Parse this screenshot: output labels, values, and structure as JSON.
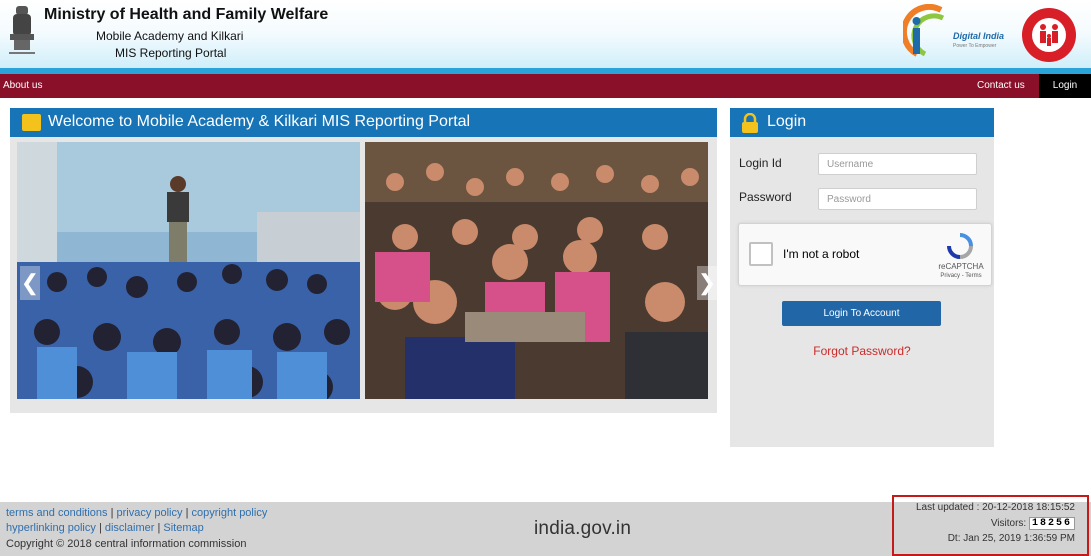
{
  "header": {
    "ministry": "Ministry of Health and Family Welfare",
    "portal_line1": "Mobile Academy and Kilkari",
    "portal_line2": "MIS Reporting Portal",
    "digital_india": "Digital India",
    "digital_india_tagline": "Power To Empower",
    "colors": {
      "nav": "#8a0f28",
      "accent": "#1674b7",
      "stripe": "#2aa3d9"
    }
  },
  "nav": {
    "about": "About us",
    "contact": "Contact us",
    "login": "Login"
  },
  "welcome": {
    "title": "Welcome to Mobile Academy & Kilkari MIS Reporting Portal",
    "icon": "image-icon"
  },
  "login": {
    "title": "Login",
    "icon": "lock-icon",
    "login_id_label": "Login Id",
    "password_label": "Password",
    "username_placeholder": "Username",
    "password_placeholder": "Password",
    "captcha_text": "I'm not a robot",
    "captcha_brand": "reCAPTCHA",
    "captcha_links": "Privacy - Terms",
    "submit": "Login To Account",
    "forgot": "Forgot Password?"
  },
  "footer": {
    "links_row1": [
      "terms and conditions",
      "privacy policy",
      "copyright policy"
    ],
    "links_row2": [
      "hyperlinking policy",
      "disclaimer",
      "Sitemap"
    ],
    "copyright": "Copyright © 2018 central information commission",
    "india_logo": "india.gov.in",
    "last_updated": "Last updated : 20-12-2018 18:15:52",
    "visitors_label": "Visitors:",
    "visitors_count": "18256",
    "datetime": "Dt: Jan 25, 2019 1:36:59 PM"
  }
}
